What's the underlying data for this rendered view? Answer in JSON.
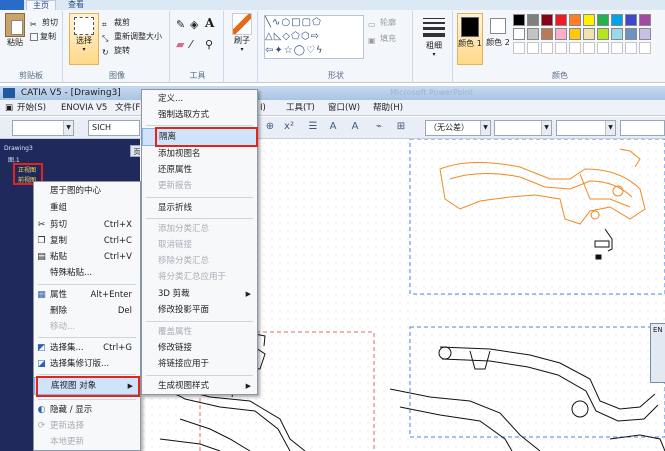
{
  "ribbon": {
    "tabs": [
      {
        "label": "",
        "kind": "file"
      },
      {
        "label": "主页",
        "kind": "active"
      },
      {
        "label": "查看",
        "kind": "normal"
      }
    ],
    "clipboard": {
      "paste": "粘贴",
      "cut": "剪切",
      "copy": "复制",
      "title": "剪贴板"
    },
    "image": {
      "select": "选择",
      "crop": "裁剪",
      "resize": "重新调整大小",
      "rotate": "旋转",
      "title": "图像"
    },
    "tools": {
      "title": "工具"
    },
    "brushes": {
      "label": "刷子"
    },
    "shapes": {
      "outline": "轮廓",
      "fill": "填充",
      "title": "形状"
    },
    "size": {
      "label": "粗细"
    },
    "colors": {
      "color1": "颜色 1",
      "color2": "颜色 2",
      "title": "颜色",
      "palette_row1": [
        "#000000",
        "#7f7f7f",
        "#880015",
        "#ed1c24",
        "#ff7f27",
        "#fff200",
        "#22b14c",
        "#00a2e8",
        "#3f48cc",
        "#a349a4"
      ],
      "palette_row2": [
        "#ffffff",
        "#c3c3c3",
        "#b97a57",
        "#ffaec9",
        "#ffc90e",
        "#efe4b0",
        "#b5e61d",
        "#99d9ea",
        "#7092be",
        "#c8bfe7"
      ]
    }
  },
  "catia": {
    "title": "CATIA V5 - [Drawing3]",
    "taskbar_blur": "Microsoft PowerPoint",
    "menubar": [
      "开始(S)",
      "ENOVIA V5",
      "文件(F",
      "I)",
      "工具(T)",
      "窗口(W)",
      "帮助(H)"
    ],
    "toolbar": {
      "font_box": "SICH",
      "tolerance_box": "（无公差）"
    },
    "tree": [
      "Drawing3",
      "图.1",
      "正视图",
      "前视图"
    ],
    "tree_tab": "页",
    "side_dialog": "EN"
  },
  "menu_left": {
    "items": [
      {
        "label": "居于图的中心",
        "shortcut": "",
        "icon": "",
        "disabled": false
      },
      {
        "label": "重组",
        "shortcut": "",
        "icon": "",
        "disabled": false
      },
      {
        "label": "剪切",
        "shortcut": "Ctrl+X",
        "icon": "scissors-icon",
        "disabled": false
      },
      {
        "label": "复制",
        "shortcut": "Ctrl+C",
        "icon": "copy-icon",
        "disabled": false
      },
      {
        "label": "粘贴",
        "shortcut": "Ctrl+V",
        "icon": "paste-icon",
        "disabled": false
      },
      {
        "label": "特殊粘贴...",
        "shortcut": "",
        "icon": "",
        "disabled": false
      },
      {
        "label": "属性",
        "shortcut": "Alt+Enter",
        "icon": "properties-icon",
        "disabled": false
      },
      {
        "label": "删除",
        "shortcut": "Del",
        "icon": "",
        "disabled": false
      },
      {
        "label": "移动...",
        "shortcut": "",
        "icon": "",
        "disabled": true
      },
      {
        "label": "选择集...",
        "shortcut": "Ctrl+G",
        "icon": "selection-set-icon",
        "disabled": false
      },
      {
        "label": "选择集修订版...",
        "shortcut": "",
        "icon": "selection-edit-icon",
        "disabled": false
      },
      {
        "label": "底视图 对象",
        "shortcut": "",
        "icon": "",
        "disabled": false
      },
      {
        "label": "隐藏 / 显示",
        "shortcut": "",
        "icon": "hide-show-icon",
        "disabled": false
      },
      {
        "label": "更新选择",
        "shortcut": "",
        "icon": "update-icon",
        "disabled": true
      },
      {
        "label": "本地更新",
        "shortcut": "",
        "icon": "",
        "disabled": true
      }
    ]
  },
  "menu_right": {
    "items": [
      {
        "label": "定义...",
        "disabled": false,
        "submenu": false
      },
      {
        "label": "强制选取方式",
        "disabled": false,
        "submenu": false
      },
      {
        "label": "隔离",
        "disabled": false,
        "submenu": false
      },
      {
        "label": "添加视图名",
        "disabled": false,
        "submenu": false
      },
      {
        "label": "还原属性",
        "disabled": false,
        "submenu": false
      },
      {
        "label": "更新报告",
        "disabled": true,
        "submenu": false
      },
      {
        "label": "显示折线",
        "disabled": false,
        "submenu": false
      },
      {
        "label": "添加分类汇总",
        "disabled": true,
        "submenu": false
      },
      {
        "label": "取消链接",
        "disabled": true,
        "submenu": false
      },
      {
        "label": "移除分类汇总",
        "disabled": true,
        "submenu": false
      },
      {
        "label": "将分类汇总应用于",
        "disabled": true,
        "submenu": false
      },
      {
        "label": "3D 剪裁",
        "disabled": false,
        "submenu": true
      },
      {
        "label": "修改投影平面",
        "disabled": false,
        "submenu": false
      },
      {
        "label": "覆盖属性",
        "disabled": true,
        "submenu": false
      },
      {
        "label": "修改链接",
        "disabled": false,
        "submenu": false
      },
      {
        "label": "将链接应用于",
        "disabled": false,
        "submenu": false
      },
      {
        "label": "生成视图样式",
        "disabled": false,
        "submenu": true
      }
    ]
  }
}
